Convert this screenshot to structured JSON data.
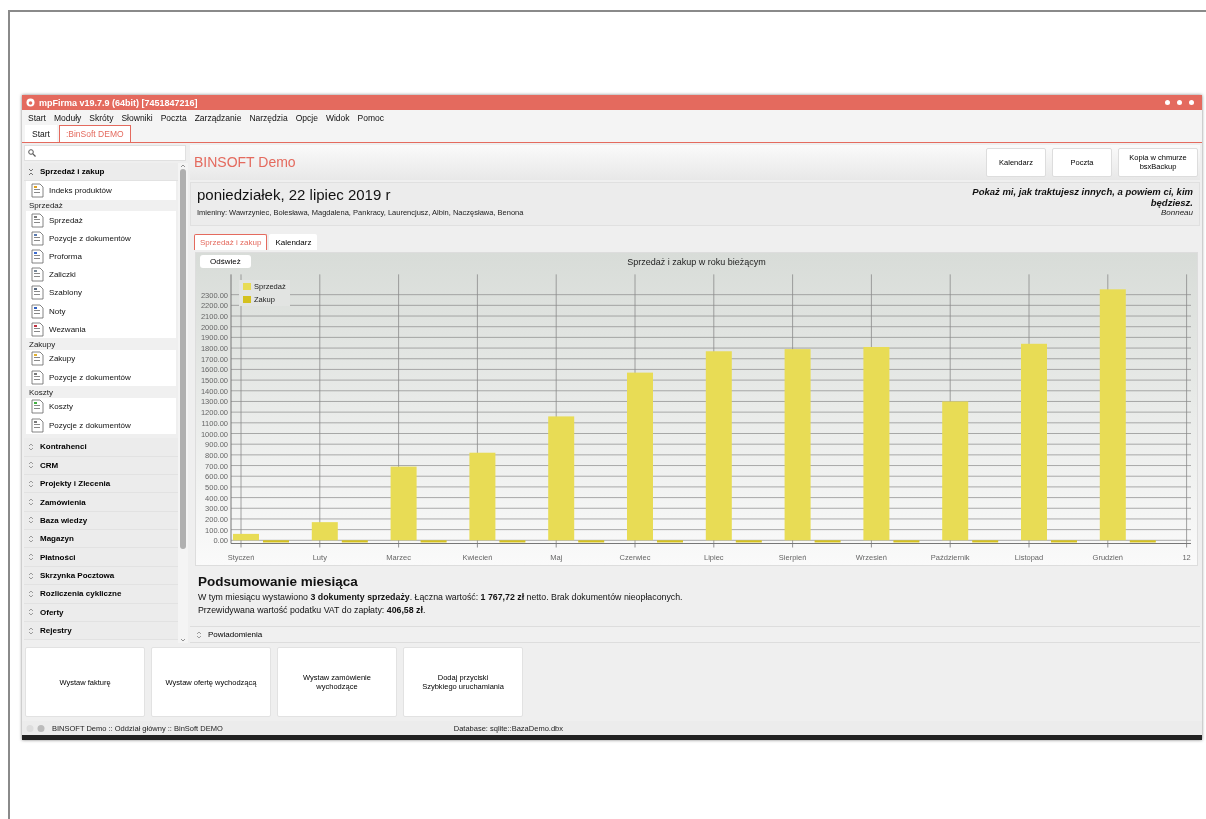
{
  "window": {
    "title": "mpFirma v19.7.9 (64bit) [7451847216]"
  },
  "menu": [
    "Start",
    "Moduły",
    "Skróty",
    "Słowniki",
    "Poczta",
    "Zarządzanie",
    "Narzędzia",
    "Opcje",
    "Widok",
    "Pomoc"
  ],
  "doc_tabs": [
    {
      "label": "Start",
      "selected": false
    },
    {
      "label": ":BinSoft DEMO",
      "selected": true
    }
  ],
  "sidebar": {
    "sections": [
      {
        "label": "Sprzedaż i zakup",
        "expanded": true,
        "groups": [
          {
            "items": [
              "Indeks produktów"
            ]
          },
          {
            "label": "Sprzedaż",
            "items": [
              "Sprzedaż",
              "Pozycje z dokumentów",
              "Proforma",
              "Zaliczki",
              "Szablony",
              "Noty",
              "Wezwania"
            ]
          },
          {
            "label": "Zakupy",
            "items": [
              "Zakupy",
              "Pozycje z dokumentów"
            ]
          },
          {
            "label": "Koszty",
            "items": [
              "Koszty",
              "Pozycje z dokumentów"
            ]
          }
        ]
      },
      {
        "label": "Kontrahenci",
        "expanded": false
      },
      {
        "label": "CRM",
        "expanded": false
      },
      {
        "label": "Projekty i Zlecenia",
        "expanded": false
      },
      {
        "label": "Zamówienia",
        "expanded": false
      },
      {
        "label": "Baza wiedzy",
        "expanded": false
      },
      {
        "label": "Magazyn",
        "expanded": false
      },
      {
        "label": "Płatności",
        "expanded": false
      },
      {
        "label": "Skrzynka Pocztowa",
        "expanded": false
      },
      {
        "label": "Rozliczenia cykliczne",
        "expanded": false
      },
      {
        "label": "Oferty",
        "expanded": false
      },
      {
        "label": "Rejestry",
        "expanded": false
      }
    ]
  },
  "header": {
    "title": "BINSOFT Demo",
    "buttons": [
      "Kalendarz",
      "Poczta",
      "Kopia w chmurze\nbsxBackup"
    ]
  },
  "date_panel": {
    "date": "poniedziałek, 22 lipiec 2019 r",
    "names": "Imieniny: Wawrzyniec, Bolesława, Magdalena, Pankracy, Laurencjusz, Albin, Naczęsława, Benona",
    "quote": "Pokaż mi, jak traktujesz innych, a powiem ci, kim będziesz.",
    "author": "Bonneau"
  },
  "content_tabs": [
    {
      "label": "Sprzedaż i zakup",
      "selected": true
    },
    {
      "label": "Kalendarz",
      "selected": false
    }
  ],
  "chart_panel": {
    "refresh_button": "Odśwież",
    "chart_data": {
      "type": "bar",
      "title": "Sprzedaż i zakup w roku bieżącym",
      "categories": [
        "Styczeń",
        "Luty",
        "Marzec",
        "Kwiecień",
        "Maj",
        "Czerwiec",
        "Lipiec",
        "Sierpień",
        "Wrzesień",
        "Październik",
        "Listopad",
        "Grudzień",
        "12"
      ],
      "series": [
        {
          "name": "Sprzedaż",
          "color": "#e8dc55",
          "values": [
            60,
            170,
            690,
            820,
            1160,
            1570,
            1770,
            1790,
            1810,
            1300,
            1840,
            2350,
            null
          ]
        },
        {
          "name": "Zakup",
          "color": "#d4c11f",
          "values": [
            -20,
            -20,
            -20,
            -20,
            -20,
            -20,
            -20,
            -20,
            -20,
            -20,
            -20,
            -20,
            null
          ]
        }
      ],
      "ylim": [
        -30,
        2490
      ],
      "grid": true,
      "yticks": [
        {
          "value": 0,
          "label": "0.00"
        },
        {
          "value": 100,
          "label": "100.00"
        },
        {
          "value": 200,
          "label": "200.00"
        },
        {
          "value": 300,
          "label": "300.00"
        },
        {
          "value": 400,
          "label": "400.00"
        },
        {
          "value": 500,
          "label": "500.00"
        },
        {
          "value": 600,
          "label": "600.00"
        },
        {
          "value": 700,
          "label": "700.00"
        },
        {
          "value": 800,
          "label": "800.00"
        },
        {
          "value": 900,
          "label": "900.00"
        },
        {
          "value": 1000,
          "label": "1000.00"
        },
        {
          "value": 1100,
          "label": "1100.00"
        },
        {
          "value": 1200,
          "label": "1200.00"
        },
        {
          "value": 1300,
          "label": "1300.00"
        },
        {
          "value": 1400,
          "label": "1400.00"
        },
        {
          "value": 1500,
          "label": "1500.00"
        },
        {
          "value": 1600,
          "label": "1600.00"
        },
        {
          "value": 1700,
          "label": "1700.00"
        },
        {
          "value": 1800,
          "label": "1800.00"
        },
        {
          "value": 1900,
          "label": "1900.00"
        },
        {
          "value": 2000,
          "label": "2000.00"
        },
        {
          "value": 2100,
          "label": "2100.00"
        },
        {
          "value": 2200,
          "label": "2200.00"
        },
        {
          "value": 2300,
          "label": "2300.00"
        }
      ]
    }
  },
  "summary": {
    "title": "Podsumowanie miesiąca",
    "lines": [
      "W tym miesiącu wystawiono **3 dokumenty sprzedaży**. Łączna wartość: **1 767,72 zł** netto. Brak dokumentów nieopłaconych.",
      "Przewidywana wartość podatku VAT do zapłaty: **406,58 zł**."
    ]
  },
  "notifications": {
    "label": "Powiadomienia",
    "expanded": false
  },
  "quick_buttons": [
    "Wystaw fakturę",
    "Wystaw ofertę wychodzącą",
    "Wystaw zamówienie\nwychodzące",
    "Dodaj przyciski\nSzybkiego uruchamiania"
  ],
  "status_bar": {
    "left": "BINSOFT Demo :: Oddział główny :: BinSoft DEMO",
    "database": "Database: sqlite::BazaDemo.dbx"
  }
}
